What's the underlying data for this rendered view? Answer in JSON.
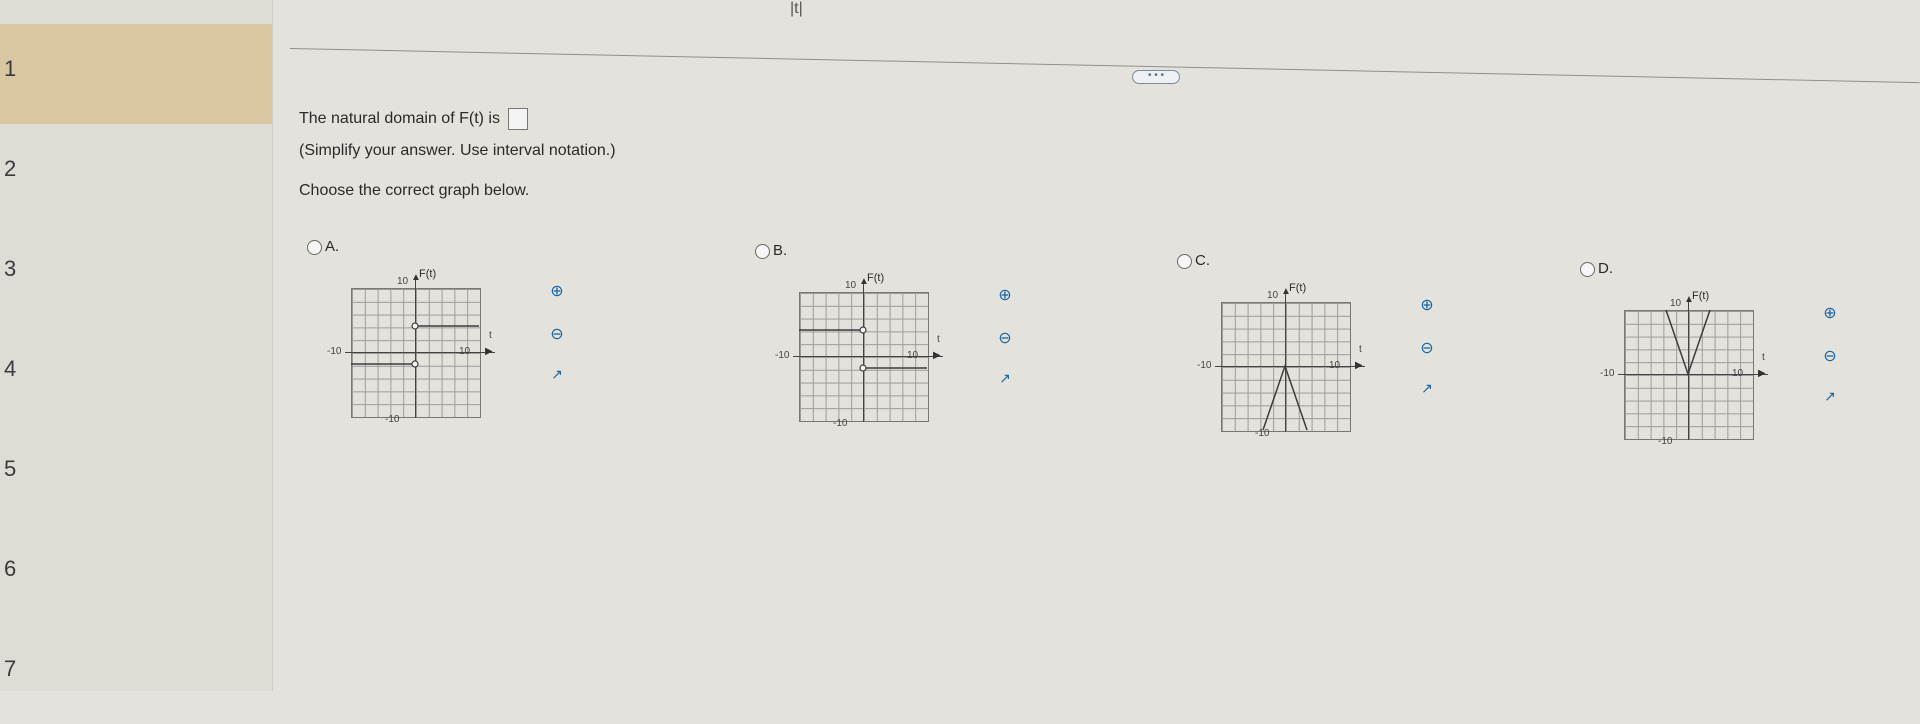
{
  "sidebar": {
    "items": [
      {
        "label": "1"
      },
      {
        "label": "2"
      },
      {
        "label": "3"
      },
      {
        "label": "4"
      },
      {
        "label": "5"
      },
      {
        "label": "6"
      },
      {
        "label": "7"
      }
    ]
  },
  "question": {
    "top_function": "|t|",
    "domain_text_prefix": "The natural domain of F(t) is",
    "hint": "(Simplify your answer. Use interval notation.)",
    "choose": "Choose the correct graph below."
  },
  "options": [
    {
      "label": "A.",
      "fn_label": "F(t)",
      "x_axis": "t",
      "top_tick": "10",
      "left_tick": "-10",
      "right_tick": "10",
      "bottom_tick": "-10"
    },
    {
      "label": "B.",
      "fn_label": "F(t)",
      "x_axis": "t",
      "top_tick": "10",
      "left_tick": "-10",
      "right_tick": "10",
      "bottom_tick": "-10"
    },
    {
      "label": "C.",
      "fn_label": "F(t)",
      "x_axis": "t",
      "top_tick": "10",
      "left_tick": "-10",
      "right_tick": "10",
      "bottom_tick": "-10"
    },
    {
      "label": "D.",
      "fn_label": "F(t)",
      "x_axis": "t",
      "top_tick": "10",
      "left_tick": "-10",
      "right_tick": "10",
      "bottom_tick": "-10"
    }
  ],
  "icons": {
    "zoom_in": "magnify-plus-icon",
    "zoom_out": "magnify-minus-icon",
    "popout": "external-link-icon"
  }
}
